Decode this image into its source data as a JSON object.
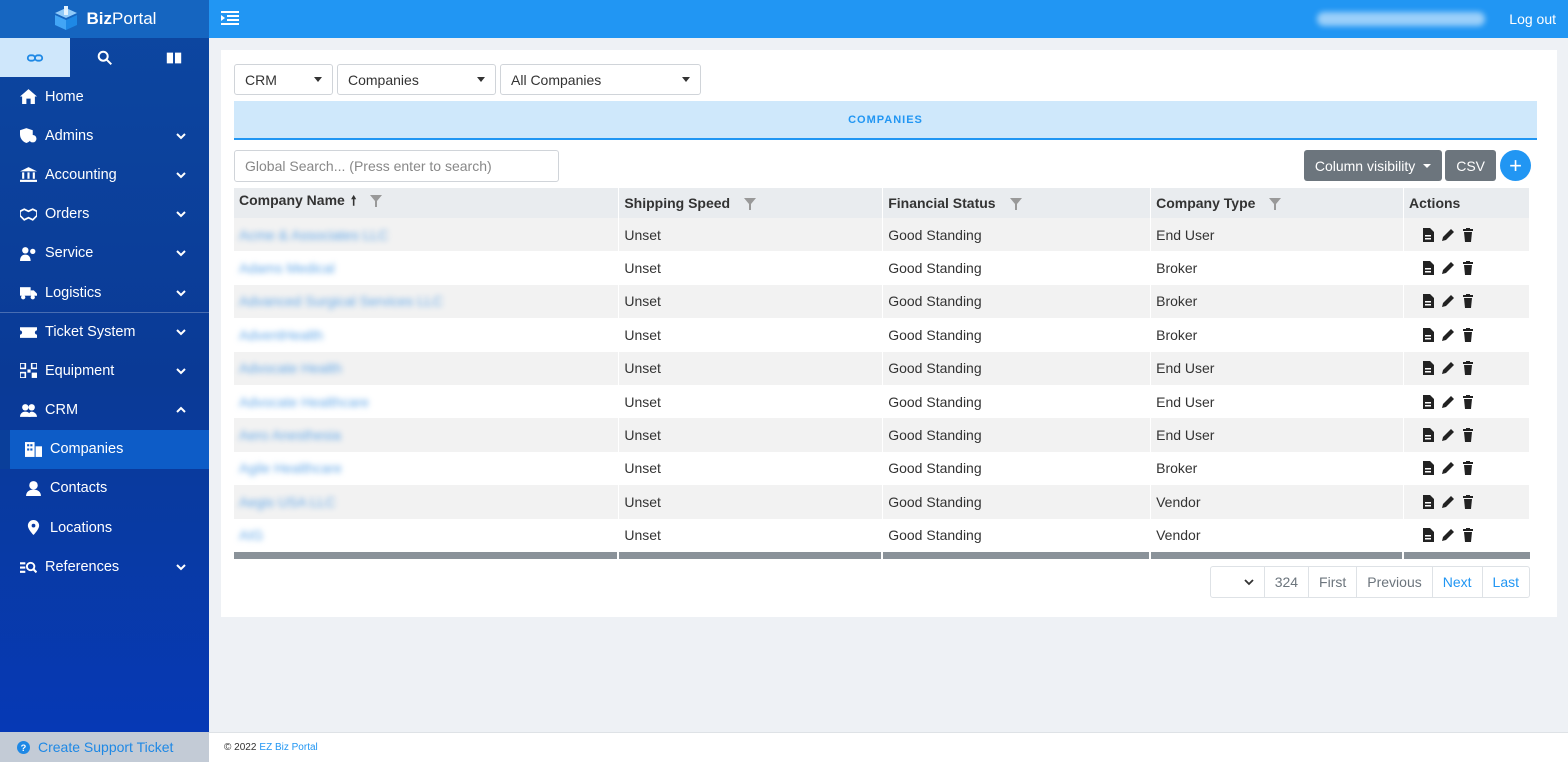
{
  "brand": {
    "name_bold": "Biz",
    "name_rest": "Portal"
  },
  "topbar": {
    "logout": "Log out"
  },
  "sidebar": {
    "nav": [
      {
        "label": "Home",
        "icon": "home-icon",
        "expand": ""
      },
      {
        "label": "Admins",
        "icon": "admin-shield-icon",
        "expand": "down"
      },
      {
        "label": "Accounting",
        "icon": "bank-icon",
        "expand": "down"
      },
      {
        "label": "Orders",
        "icon": "handshake-icon",
        "expand": "down"
      },
      {
        "label": "Service",
        "icon": "service-users-icon",
        "expand": "down"
      },
      {
        "label": "Logistics",
        "icon": "truck-icon",
        "expand": "down"
      },
      {
        "label": "Ticket System",
        "icon": "ticket-icon",
        "expand": "down"
      },
      {
        "label": "Equipment",
        "icon": "equipment-icon",
        "expand": "down"
      },
      {
        "label": "CRM",
        "icon": "users-icon",
        "expand": "up"
      }
    ],
    "crm_sub": [
      {
        "label": "Companies",
        "icon": "building-icon"
      },
      {
        "label": "Contacts",
        "icon": "person-icon"
      },
      {
        "label": "Locations",
        "icon": "map-pin-icon"
      }
    ],
    "references": {
      "label": "References",
      "icon": "references-search-icon"
    },
    "support": "Create Support Ticket"
  },
  "filters": {
    "module": "CRM",
    "entity": "Companies",
    "view": "All Companies"
  },
  "banner": "COMPANIES",
  "search": {
    "placeholder": "Global Search... (Press enter to search)"
  },
  "tools": {
    "column_visibility": "Column visibility",
    "csv": "CSV",
    "add": "+"
  },
  "table": {
    "columns": [
      "Company Name",
      "Shipping Speed",
      "Financial Status",
      "Company Type",
      "Actions"
    ],
    "rows": [
      {
        "name": "Acme & Associates LLC",
        "speed": "Unset",
        "status": "Good Standing",
        "type": "End User"
      },
      {
        "name": "Adams Medical",
        "speed": "Unset",
        "status": "Good Standing",
        "type": "Broker"
      },
      {
        "name": "Advanced Surgical Services LLC",
        "speed": "Unset",
        "status": "Good Standing",
        "type": "Broker"
      },
      {
        "name": "AdventHealth",
        "speed": "Unset",
        "status": "Good Standing",
        "type": "Broker"
      },
      {
        "name": "Advocate Health",
        "speed": "Unset",
        "status": "Good Standing",
        "type": "End User"
      },
      {
        "name": "Advocate Healthcare",
        "speed": "Unset",
        "status": "Good Standing",
        "type": "End User"
      },
      {
        "name": "Aero Anesthesia",
        "speed": "Unset",
        "status": "Good Standing",
        "type": "End User"
      },
      {
        "name": "Agile Healthcare",
        "speed": "Unset",
        "status": "Good Standing",
        "type": "Broker"
      },
      {
        "name": "Aegis USA LLC",
        "speed": "Unset",
        "status": "Good Standing",
        "type": "Vendor"
      },
      {
        "name": "AIG",
        "speed": "Unset",
        "status": "Good Standing",
        "type": "Vendor"
      }
    ]
  },
  "pagination": {
    "total": "324",
    "first": "First",
    "previous": "Previous",
    "next": "Next",
    "last": "Last"
  },
  "footer": {
    "copyright": "© 2022",
    "link": "EZ Biz Portal"
  }
}
